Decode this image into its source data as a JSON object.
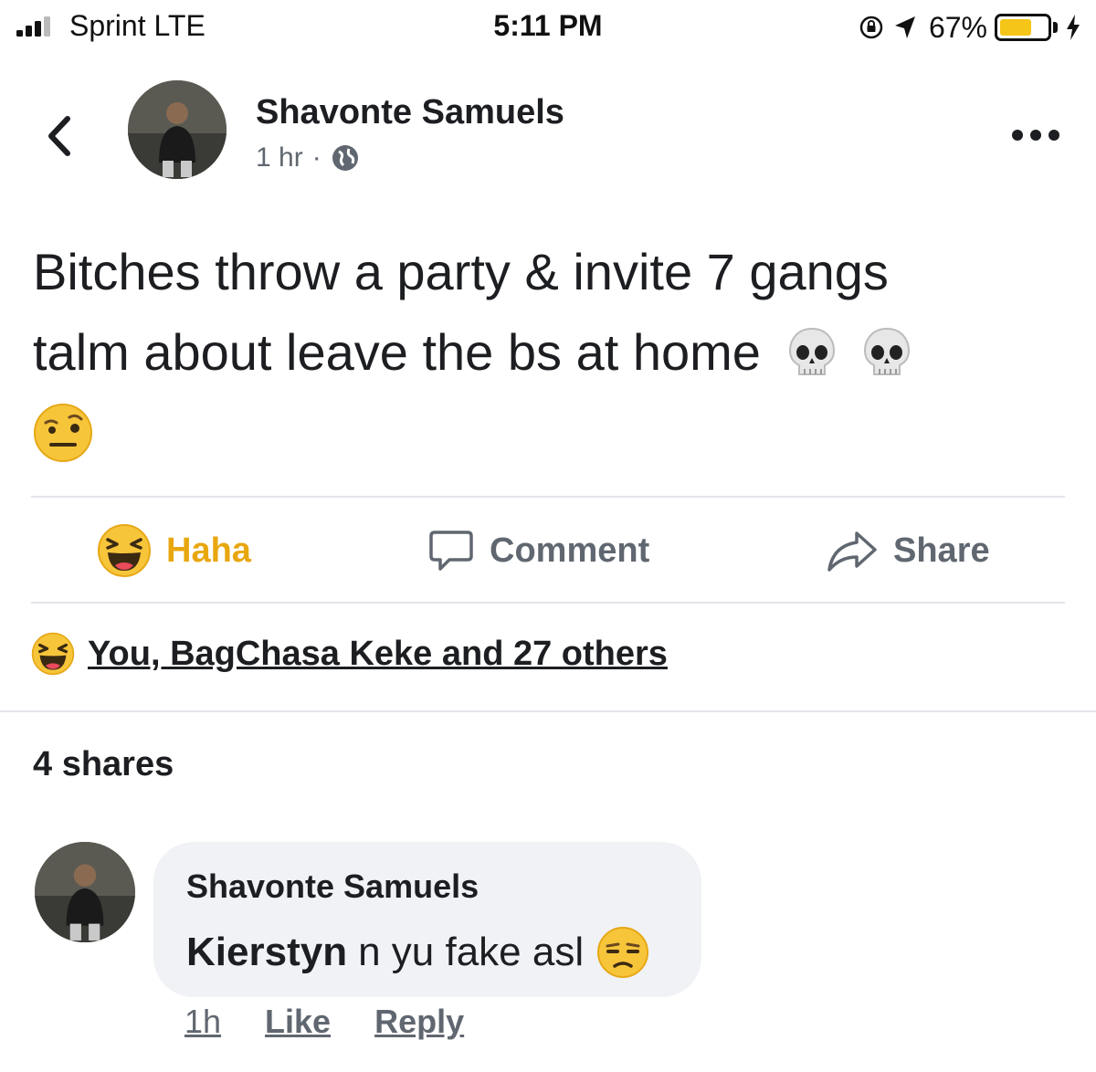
{
  "status_bar": {
    "carrier": "Sprint  LTE",
    "time": "5:11 PM",
    "battery_percent": "67%",
    "battery_level": 0.67,
    "battery_color": "#f5c518"
  },
  "post": {
    "author": "Shavonte Samuels",
    "time": "1 hr",
    "separator": "·",
    "privacy_icon": "globe-icon",
    "text_line1": "Bitches throw a party & invite 7 gangs",
    "text_line2": "talm about leave the bs at home",
    "emojis": [
      "skull-emoji",
      "skull-emoji",
      "raised-eyebrow-emoji"
    ]
  },
  "actions": {
    "haha_label": "Haha",
    "comment_label": "Comment",
    "share_label": "Share",
    "haha_color": "#e8a70f"
  },
  "reactions": {
    "summary": "You, BagChasa Keke and 27 others",
    "icon": "haha-emoji"
  },
  "shares_text": "4 shares",
  "comment": {
    "author": "Shavonte Samuels",
    "mention": "Kierstyn",
    "text": "n yu fake asl",
    "emoji": "unamused-emoji",
    "time": "1h",
    "like_label": "Like",
    "reply_label": "Reply"
  }
}
